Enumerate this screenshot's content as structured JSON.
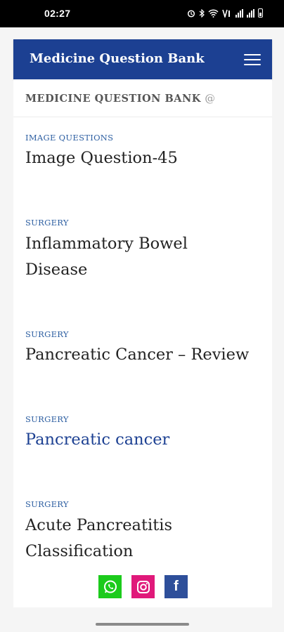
{
  "status_bar": {
    "time": "02:27"
  },
  "header": {
    "title": "Medicine Question Bank"
  },
  "subheader": {
    "title": "MEDICINE QUESTION BANK",
    "suffix": "@"
  },
  "posts": [
    {
      "category": "IMAGE QUESTIONS",
      "title": "Image Question-45"
    },
    {
      "category": "SURGERY",
      "title_line1": "Inflammatory Bowel",
      "title_line2": "Disease"
    },
    {
      "category": "SURGERY",
      "title": "Pancreatic Cancer – Review"
    },
    {
      "category": "SURGERY",
      "title": "Pancreatic cancer"
    },
    {
      "category": "SURGERY",
      "title_line1": "Acute Pancreatitis",
      "title_line2": "Classification"
    }
  ],
  "social": [
    "whatsapp-icon",
    "instagram-icon",
    "facebook-icon"
  ],
  "colors": {
    "header_bg": "#1c4092",
    "category": "#2c5ea1",
    "whatsapp": "#1ccb1c",
    "instagram": "#e0197a",
    "facebook": "#2e4f9a"
  }
}
